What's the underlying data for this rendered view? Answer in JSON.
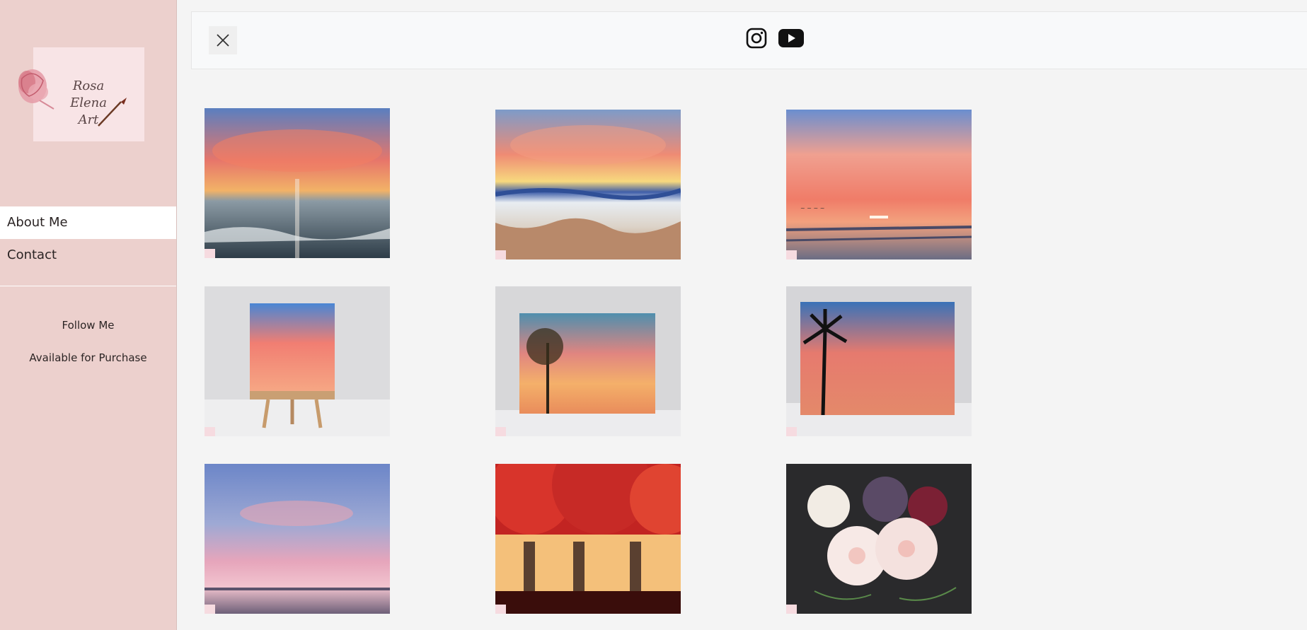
{
  "brand": {
    "logo_line1": "Rosa Elena",
    "logo_line2": "Art"
  },
  "nav": {
    "items": [
      {
        "label": "About Me",
        "active": true
      },
      {
        "label": "Contact",
        "active": false
      }
    ]
  },
  "sidebar_links": {
    "follow": "Follow Me",
    "purchase": "Available for Purchase"
  },
  "topbar": {
    "close_icon": "close-icon",
    "social_icons": [
      "instagram-icon",
      "youtube-icon"
    ]
  },
  "gallery": {
    "count": 9,
    "watermark_icon": "rose-watermark-icon"
  },
  "colors": {
    "sidebar_bg": "#ecd0cd",
    "page_bg": "#f4f4f4",
    "topbar_bg": "#f8f9fa"
  }
}
